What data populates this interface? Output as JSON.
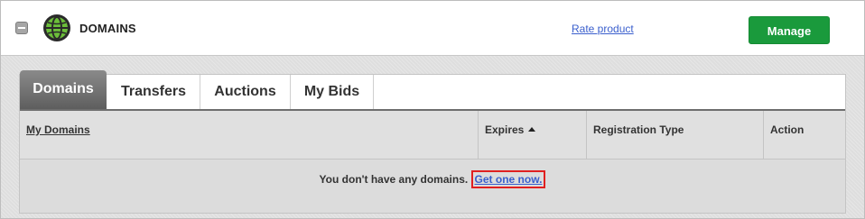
{
  "header": {
    "title": "DOMAINS",
    "rate_link": "Rate product",
    "manage_button": "Manage",
    "collapse_icon": "minus-square-icon",
    "product_icon": "globe-icon"
  },
  "tabs": [
    {
      "label": "Domains",
      "active": true
    },
    {
      "label": "Transfers",
      "active": false
    },
    {
      "label": "Auctions",
      "active": false
    },
    {
      "label": "My Bids",
      "active": false
    }
  ],
  "table": {
    "columns": [
      {
        "label": "My Domains",
        "sortable": true
      },
      {
        "label": "Expires",
        "sorted": "ascending"
      },
      {
        "label": "Registration Type"
      },
      {
        "label": "Action"
      }
    ],
    "empty_message": "You don't have any domains.",
    "empty_link": "Get one now."
  },
  "colors": {
    "manage_green": "#1a9a3c",
    "link_blue": "#3a5fcd",
    "highlight_red": "#e02020"
  }
}
